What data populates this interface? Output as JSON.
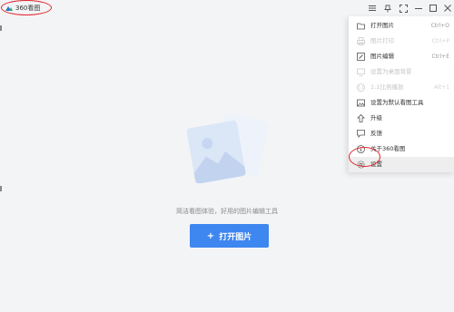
{
  "app": {
    "title": "360看图"
  },
  "empty_state": {
    "hint": "简洁看图体验，好用的图片编辑工具",
    "open_button": {
      "plus": "+",
      "label": "打开图片"
    }
  },
  "menu": {
    "items": [
      {
        "label": "打开图片",
        "shortcut": "Ctrl+O",
        "icon": "folder-open-icon",
        "enabled": true
      },
      {
        "label": "图片打印",
        "shortcut": "Ctrl+P",
        "icon": "printer-icon",
        "enabled": false
      },
      {
        "label": "图片编辑",
        "shortcut": "Ctrl+E",
        "icon": "edit-icon",
        "enabled": true
      },
      {
        "label": "设置为桌面背景",
        "shortcut": "",
        "icon": "desktop-icon",
        "enabled": false
      },
      {
        "label": "1:1比例播放",
        "shortcut": "Alt+1",
        "icon": "ratio-icon",
        "enabled": false
      },
      {
        "label": "设置为默认看图工具",
        "shortcut": "",
        "icon": "image-icon",
        "enabled": true
      },
      {
        "label": "升级",
        "shortcut": "",
        "icon": "upgrade-icon",
        "enabled": true
      },
      {
        "label": "反馈",
        "shortcut": "",
        "icon": "feedback-icon",
        "enabled": true
      },
      {
        "label": "关于360看图",
        "shortcut": "",
        "icon": "info-icon",
        "enabled": true
      },
      {
        "label": "设置",
        "shortcut": "",
        "icon": "gear-icon",
        "enabled": true,
        "highlighted": true
      }
    ]
  },
  "colors": {
    "accent": "#3e86f0",
    "annotation": "#e0262d"
  }
}
